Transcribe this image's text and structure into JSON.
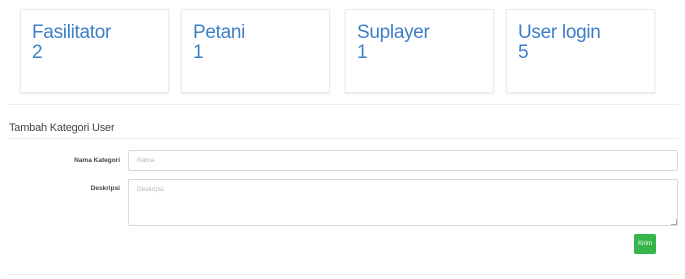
{
  "stats": [
    {
      "label": "Fasilitator",
      "value": "2"
    },
    {
      "label": "Petani",
      "value": "1"
    },
    {
      "label": "Suplayer",
      "value": "1"
    },
    {
      "label": "User login",
      "value": "5"
    }
  ],
  "form": {
    "title": "Tambah Kategori User",
    "nama_label": "Nama Kategori",
    "nama_placeholder": "Nama",
    "nama_value": "",
    "deskripsi_label": "Deskripsi",
    "deskripsi_placeholder": "Deskripsi",
    "deskripsi_value": "",
    "submit_label": "Kirim"
  },
  "colors": {
    "accent": "#3d7ec7",
    "button": "#35b54a"
  }
}
